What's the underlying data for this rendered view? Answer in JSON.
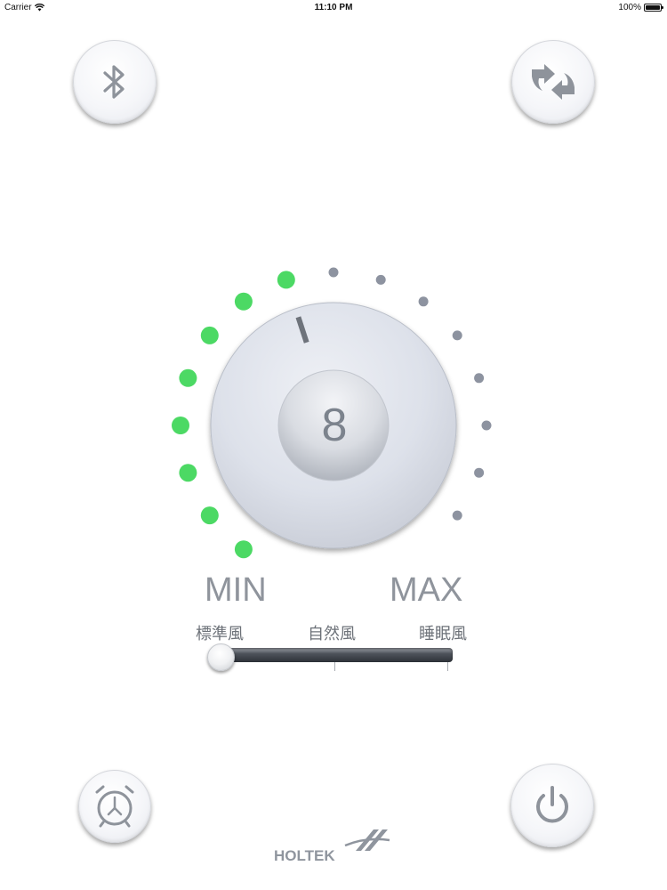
{
  "status_bar": {
    "carrier": "Carrier",
    "time": "11:10 PM",
    "battery": "100%"
  },
  "controls": {
    "bluetooth_icon": "bluetooth-icon",
    "refresh_icon": "swap-arrows-icon",
    "timer_icon": "alarm-clock-icon",
    "power_icon": "power-icon"
  },
  "dial": {
    "value": "8",
    "level": 8,
    "total_levels": 16,
    "active_color": "#4cd964",
    "inactive_color": "#8d93a0"
  },
  "range_labels": {
    "min": "MIN",
    "max": "MAX"
  },
  "mode_slider": {
    "options": [
      "標準風",
      "自然風",
      "睡眠風"
    ],
    "selected_index": 0
  },
  "brand": {
    "logo_text": "HOLTEK"
  }
}
